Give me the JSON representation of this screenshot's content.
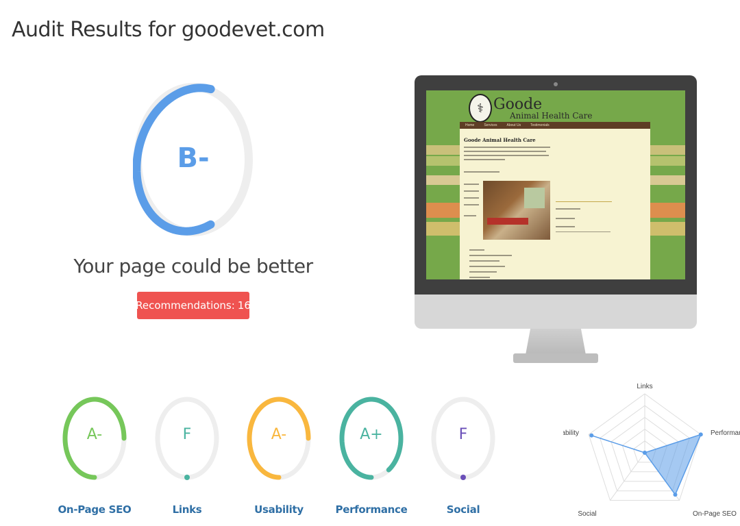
{
  "page_title": "Audit Results for goodevet.com",
  "overall": {
    "grade": "B-",
    "score_fraction": 0.6,
    "headline": "Your page could be better",
    "recommendations_label": "Recommendations:",
    "recommendations_count": "16",
    "color": "#5b9de8"
  },
  "preview_site": {
    "logo_glyph": "⚕",
    "name_line1": "Goode",
    "name_line2": "Animal Health Care",
    "nav": [
      "Home",
      "Services",
      "About Us",
      "Testimonials"
    ],
    "heading": "Goode Animal Health Care"
  },
  "categories": [
    {
      "name": "On-Page SEO",
      "grade": "A-",
      "color": "#76c75a",
      "fraction": 0.75
    },
    {
      "name": "Links",
      "grade": "F",
      "color": "#4ab3a0",
      "fraction": 0.0
    },
    {
      "name": "Usability",
      "grade": "A-",
      "color": "#f9b73e",
      "fraction": 0.75
    },
    {
      "name": "Performance",
      "grade": "A+",
      "color": "#4ab3a0",
      "fraction": 0.9
    },
    {
      "name": "Social",
      "grade": "F",
      "color": "#6a4fb8",
      "fraction": 0.0
    }
  ],
  "radar": {
    "axes": [
      "Links",
      "Performance",
      "On-Page SEO",
      "Social",
      "Usability"
    ],
    "values": [
      0.0,
      1.0,
      0.88,
      0.0,
      0.95
    ],
    "fill": "#5b9de8"
  }
}
